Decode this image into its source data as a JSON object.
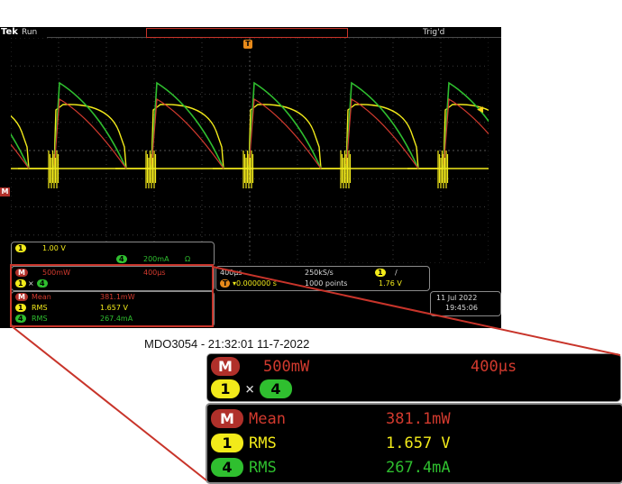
{
  "status": {
    "brand": "Tek",
    "run_state": "Run",
    "trigger_state": "Trig'd"
  },
  "markers": {
    "math": "M",
    "trigger_pos": "T"
  },
  "channel_panel": {
    "ch1_label": "1",
    "ch1_scale": "1.00 V",
    "ch4_label": "4",
    "ch4_scale": "200mA",
    "ch4_symbol": "Ω"
  },
  "math_panel": {
    "label": "M",
    "scale": "500mW",
    "time": "400μs",
    "src_a": "1",
    "op": "×",
    "src_b": "4"
  },
  "timebase": {
    "time_div": "400μs",
    "sample_rate": "250kS/s",
    "trig_ch": "1",
    "trig_slope": "/",
    "trig_pos_marker": "T",
    "trig_pos": "▾0.000000 s",
    "record_len": "1000 points",
    "trig_level": "1.76 V"
  },
  "date": {
    "day": "11 Jul  2022",
    "time": "19:45:06"
  },
  "measurements": [
    {
      "badge": "M",
      "name": "Mean",
      "value": "381.1mW",
      "color": "red"
    },
    {
      "badge": "1",
      "name": "RMS",
      "value": "1.657 V",
      "color": "yellow"
    },
    {
      "badge": "4",
      "name": "RMS",
      "value": "267.4mA",
      "color": "green"
    }
  ],
  "caption": "MDO3054 - 21:32:01   11-7-2022",
  "zoom_math": {
    "label": "M",
    "scale": "500mW",
    "time": "400μs",
    "src_a": "1",
    "op": "×",
    "src_b": "4"
  },
  "colors": {
    "ch1": "#f2ea1a",
    "ch4": "#2fbf2f",
    "math": "#d23a2e",
    "highlight": "#c8342a"
  }
}
